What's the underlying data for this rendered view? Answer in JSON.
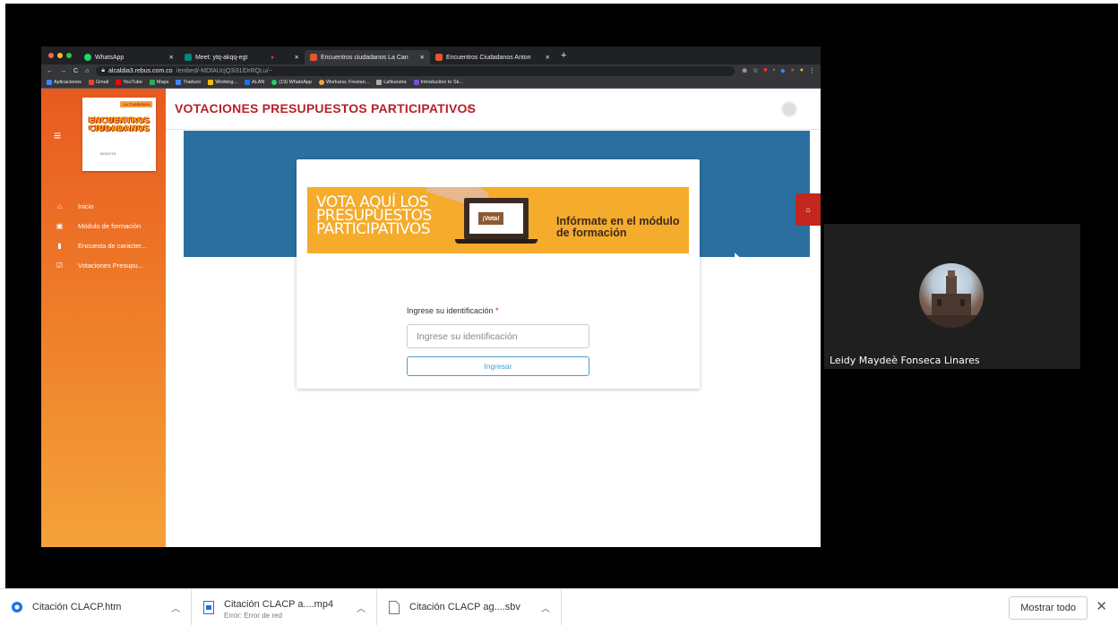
{
  "browser": {
    "tabs": [
      {
        "label": "WhatsApp",
        "fav": "#25d366"
      },
      {
        "label": "Meet: ytq-akqq-egt",
        "fav": "#00897b"
      },
      {
        "label": "",
        "fav": "#e53935"
      },
      {
        "label": "Encuentros ciudadanos La Can",
        "fav": "#e8542a"
      },
      {
        "label": "Encuentros Ciudadanos Anton",
        "fav": "#e8542a"
      }
    ],
    "new_tab": "+",
    "url_host": "alcaldia3.rebus.com.co",
    "url_path": "/embed/-MDfAUcjQ3i31lDrRQLu/--",
    "bookmarks": [
      "Aplicaciones",
      "Gmail",
      "YouTube",
      "Maps",
      "Traducir",
      "Working...",
      "ALAN",
      "(19) WhatsApp",
      "Workana: Freelan...",
      "LaNuestra",
      "Introduction to Sk..."
    ]
  },
  "app": {
    "title": "VOTACIONES PRESUPUESTOS PARTICIPATIVOS",
    "logo_tag": "La Candelaria",
    "logo_title": "ENCUENTROS CIUDADANOS",
    "logo_footer": "BOGOTÁ",
    "menu": [
      {
        "icon": "home-icon",
        "label": "Inicio"
      },
      {
        "icon": "book-icon",
        "label": "Módulo de formación"
      },
      {
        "icon": "bar-chart-icon",
        "label": "Encuesta de caracter..."
      },
      {
        "icon": "checkbox-icon",
        "label": "Votaciones Presupu..."
      }
    ],
    "banner": {
      "left": "VOTA AQUÍ LOS PRESUPUESTOS PARTICIPATIVOS",
      "vote": "¡Vota!",
      "right": "Infórmate en el módulo de formación"
    },
    "form": {
      "label": "Ingrese su identificación",
      "required_mark": "*",
      "placeholder": "Ingrese su identificación",
      "submit": "Ingresar"
    }
  },
  "meet": {
    "participant_name": "Leidy Maydeè Fonseca Linares"
  },
  "downloads": {
    "items": [
      {
        "name": "Citación CLACP.htm",
        "sub": ""
      },
      {
        "name": "Citación CLACP a....mp4",
        "sub": "Error: Error de red"
      },
      {
        "name": "Citación CLACP ag....sbv",
        "sub": ""
      }
    ],
    "show_all": "Mostrar todo",
    "close": "✕"
  },
  "colors": {
    "brand_red": "#b8212a",
    "sidebar_orange": "#e85a20",
    "band_blue": "#2b6fa1",
    "banner_yellow": "#f5ab2b",
    "button_blue": "#4d9fc8"
  }
}
